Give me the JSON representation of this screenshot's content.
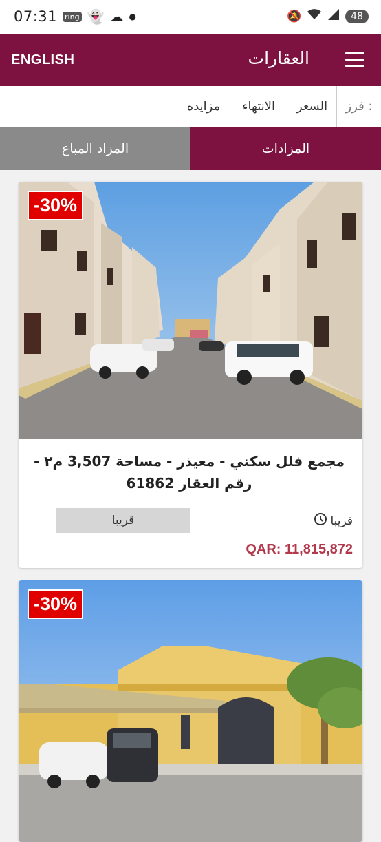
{
  "status_bar": {
    "time": "07:31",
    "ring_badge": "ring",
    "battery": "48"
  },
  "header": {
    "language_button": "ENGLISH",
    "title": "العقارات"
  },
  "sort_bar": {
    "label": "فرز :",
    "options": [
      "السعر",
      "الانتهاء",
      "مزايده"
    ]
  },
  "tabs": [
    {
      "label": "المزادات",
      "active": true
    },
    {
      "label": "المزاد المباع",
      "active": false
    }
  ],
  "colors": {
    "brand": "#7d1240",
    "inactive_tab": "#8a8a8a",
    "discount": "#e00000",
    "price": "#b2394b"
  },
  "listings": [
    {
      "discount": "-30%",
      "title": "مجمع فلل سكني - معيذر - مساحة 3,507 م٢ - رقم العقار 61862",
      "button_label": "قريبا",
      "status": "قريبا",
      "price": "QAR: 11,815,872"
    },
    {
      "discount": "-30%"
    }
  ]
}
